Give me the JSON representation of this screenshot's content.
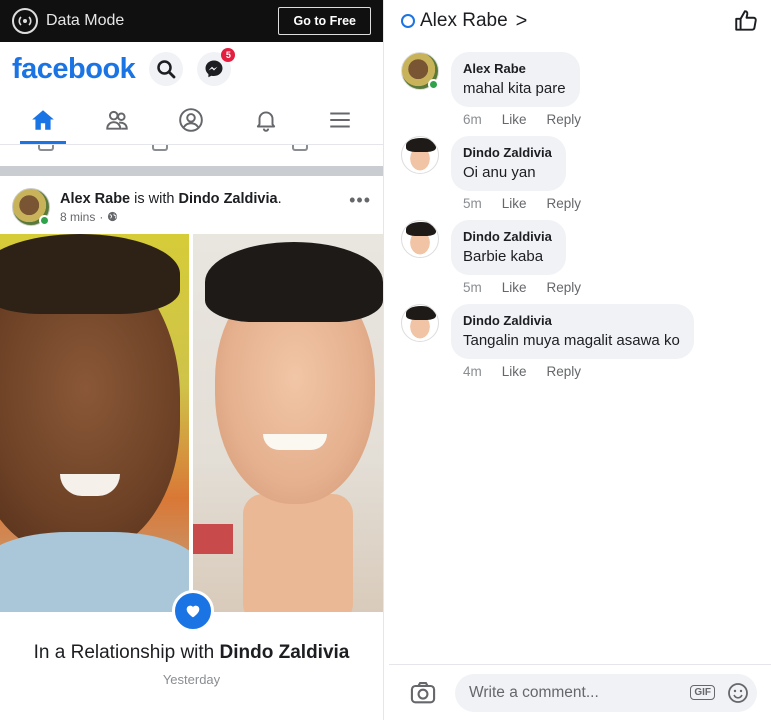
{
  "left": {
    "topbar": {
      "data_mode_label": "Data Mode",
      "go_free_label": "Go to Free"
    },
    "header": {
      "logo": "facebook",
      "messenger_badge": "5"
    },
    "post": {
      "author": "Alex Rabe",
      "with_text": " is with ",
      "tagged": "Dindo Zaldivia",
      "time": "8 mins",
      "more": "•••",
      "relationship_prefix": "In a Relationship with ",
      "relationship_name": "Dindo Zaldivia",
      "relationship_date": "Yesterday"
    }
  },
  "right": {
    "header": {
      "name": "Alex Rabe",
      "chevron": ">"
    },
    "comments": [
      {
        "name": "Alex Rabe",
        "text": "mahal kita pare",
        "time": "6m",
        "like": "Like",
        "reply": "Reply"
      },
      {
        "name": "Dindo Zaldivia",
        "text": "Oi anu yan",
        "time": "5m",
        "like": "Like",
        "reply": "Reply"
      },
      {
        "name": "Dindo Zaldivia",
        "text": "Barbie kaba",
        "time": "5m",
        "like": "Like",
        "reply": "Reply"
      },
      {
        "name": "Dindo Zaldivia",
        "text": "Tangalin muya magalit asawa ko",
        "time": "4m",
        "like": "Like",
        "reply": "Reply"
      }
    ],
    "composer": {
      "placeholder": "Write a comment...",
      "gif_label": "GIF"
    }
  },
  "colors": {
    "brand_blue": "#1b74e4",
    "online_green": "#31a24c",
    "badge_red": "#e41e3f"
  }
}
